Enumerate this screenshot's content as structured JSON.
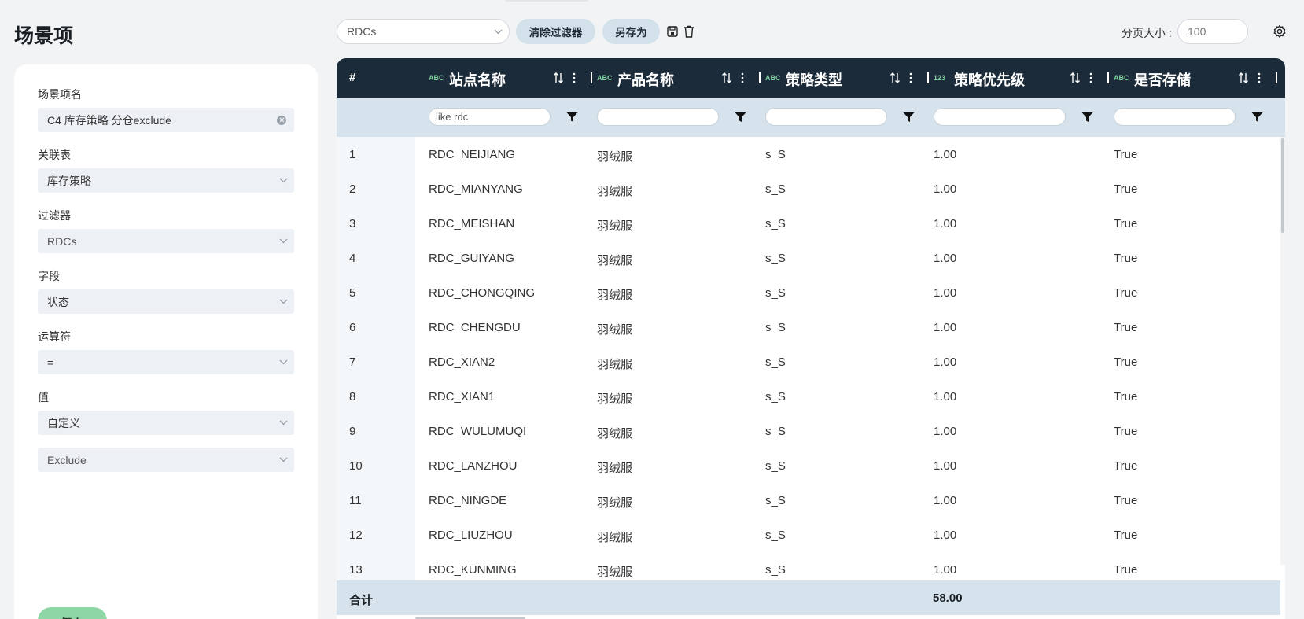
{
  "page": {
    "title": "场景项"
  },
  "form": {
    "name_label": "场景项名",
    "name_value": "C4 库存策略 分仓exclude",
    "table_label": "关联表",
    "table_value": "库存策略",
    "filter_label": "过滤器",
    "filter_value": "RDCs",
    "field_label": "字段",
    "field_value": "状态",
    "operator_label": "运算符",
    "operator_value": "=",
    "value_label": "值",
    "value_mode": "自定义",
    "value_custom": "Exclude",
    "save_label": "保存"
  },
  "toolbar": {
    "filter_select": "RDCs",
    "clear_filter_label": "清除过滤器",
    "save_as_label": "另存为",
    "page_size_label": "分页大小 :",
    "page_size_placeholder": "100"
  },
  "grid": {
    "index_header": "#",
    "columns": [
      {
        "type": "ABC",
        "title": "站点名称",
        "filter": "like rdc"
      },
      {
        "type": "ABC",
        "title": "产品名称",
        "filter": ""
      },
      {
        "type": "ABC",
        "title": "策略类型",
        "filter": ""
      },
      {
        "type": "123",
        "title": "策略优先级",
        "filter": ""
      },
      {
        "type": "ABC",
        "title": "是否存储",
        "filter": ""
      }
    ],
    "rows": [
      [
        "1",
        "RDC_NEIJIANG",
        "羽绒服",
        "s_S",
        "1.00",
        "True"
      ],
      [
        "2",
        "RDC_MIANYANG",
        "羽绒服",
        "s_S",
        "1.00",
        "True"
      ],
      [
        "3",
        "RDC_MEISHAN",
        "羽绒服",
        "s_S",
        "1.00",
        "True"
      ],
      [
        "4",
        "RDC_GUIYANG",
        "羽绒服",
        "s_S",
        "1.00",
        "True"
      ],
      [
        "5",
        "RDC_CHONGQING",
        "羽绒服",
        "s_S",
        "1.00",
        "True"
      ],
      [
        "6",
        "RDC_CHENGDU",
        "羽绒服",
        "s_S",
        "1.00",
        "True"
      ],
      [
        "7",
        "RDC_XIAN2",
        "羽绒服",
        "s_S",
        "1.00",
        "True"
      ],
      [
        "8",
        "RDC_XIAN1",
        "羽绒服",
        "s_S",
        "1.00",
        "True"
      ],
      [
        "9",
        "RDC_WULUMUQI",
        "羽绒服",
        "s_S",
        "1.00",
        "True"
      ],
      [
        "10",
        "RDC_LANZHOU",
        "羽绒服",
        "s_S",
        "1.00",
        "True"
      ],
      [
        "11",
        "RDC_NINGDE",
        "羽绒服",
        "s_S",
        "1.00",
        "True"
      ],
      [
        "12",
        "RDC_LIUZHOU",
        "羽绒服",
        "s_S",
        "1.00",
        "True"
      ],
      [
        "13",
        "RDC_KUNMING",
        "羽绒服",
        "s_S",
        "1.00",
        "True"
      ]
    ],
    "totals_label": "合计",
    "totals_priority": "58.00"
  },
  "icons": {
    "chevron": "chevron-down-icon",
    "clear": "clear-icon",
    "save_view": "save-icon",
    "delete": "trash-icon",
    "settings": "gear-icon",
    "sort": "sort-icon",
    "column_menu": "more-vertical-icon",
    "funnel": "filter-icon"
  },
  "colors": {
    "header_bg": "#1c2b3a",
    "filter_row_bg": "#d6e3ec",
    "type_tag": "#7fd3a0",
    "save_button": "#8fd6a6",
    "pill_button": "#d3e1ea"
  }
}
